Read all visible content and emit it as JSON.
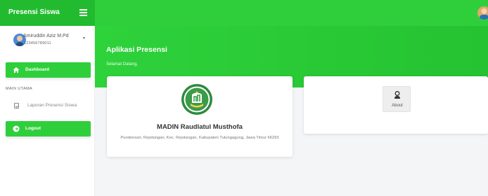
{
  "header": {
    "brand": "Presensi Siswa",
    "menu_icon": "hamburger-icon",
    "avatar_icon": "user-avatar-icon"
  },
  "sidebar": {
    "user": {
      "name": "Amiruddin Aziz M.Pd",
      "id": "123456789011",
      "caret": "▾"
    },
    "dashboard_label": "Dashboard",
    "section_label": "MAIN UTAMA",
    "menu_item_label": "Laporan Presensi Siswa",
    "logout_label": "Logout"
  },
  "main": {
    "title": "Aplikasi Presensi",
    "subtitle": "Selamat Datang,",
    "school": {
      "name": "MADIN Raudlatul Musthofa",
      "address": "Pundensari, Rejotangan, Kec. Rejotangan, Kabupaten Tulungagung, Jawa Timur 66293"
    },
    "about_label": "About"
  },
  "colors": {
    "primary_green": "#2fcf3c",
    "dark_green": "#22bb2f",
    "background": "#f4f5f7"
  }
}
